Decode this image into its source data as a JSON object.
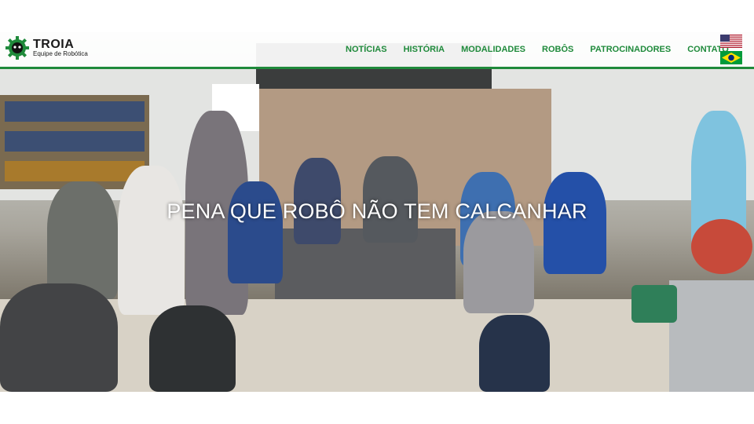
{
  "logo": {
    "name": "TROIA",
    "subtitle": "Equipe de Robótica",
    "icon": "gear-icon"
  },
  "nav": {
    "items": [
      {
        "label": "NOTÍCIAS"
      },
      {
        "label": "HISTÓRIA"
      },
      {
        "label": "MODALIDADES"
      },
      {
        "label": "ROBÔS"
      },
      {
        "label": "PATROCINADORES"
      },
      {
        "label": "CONTATO"
      }
    ]
  },
  "languages": [
    {
      "icon": "us-flag-icon"
    },
    {
      "icon": "brazil-flag-icon"
    }
  ],
  "hero": {
    "headline": "PENA QUE ROBÔ NÃO TEM CALCANHAR"
  },
  "colors": {
    "accent": "#1f8a3b",
    "headline": "#ffffff"
  }
}
